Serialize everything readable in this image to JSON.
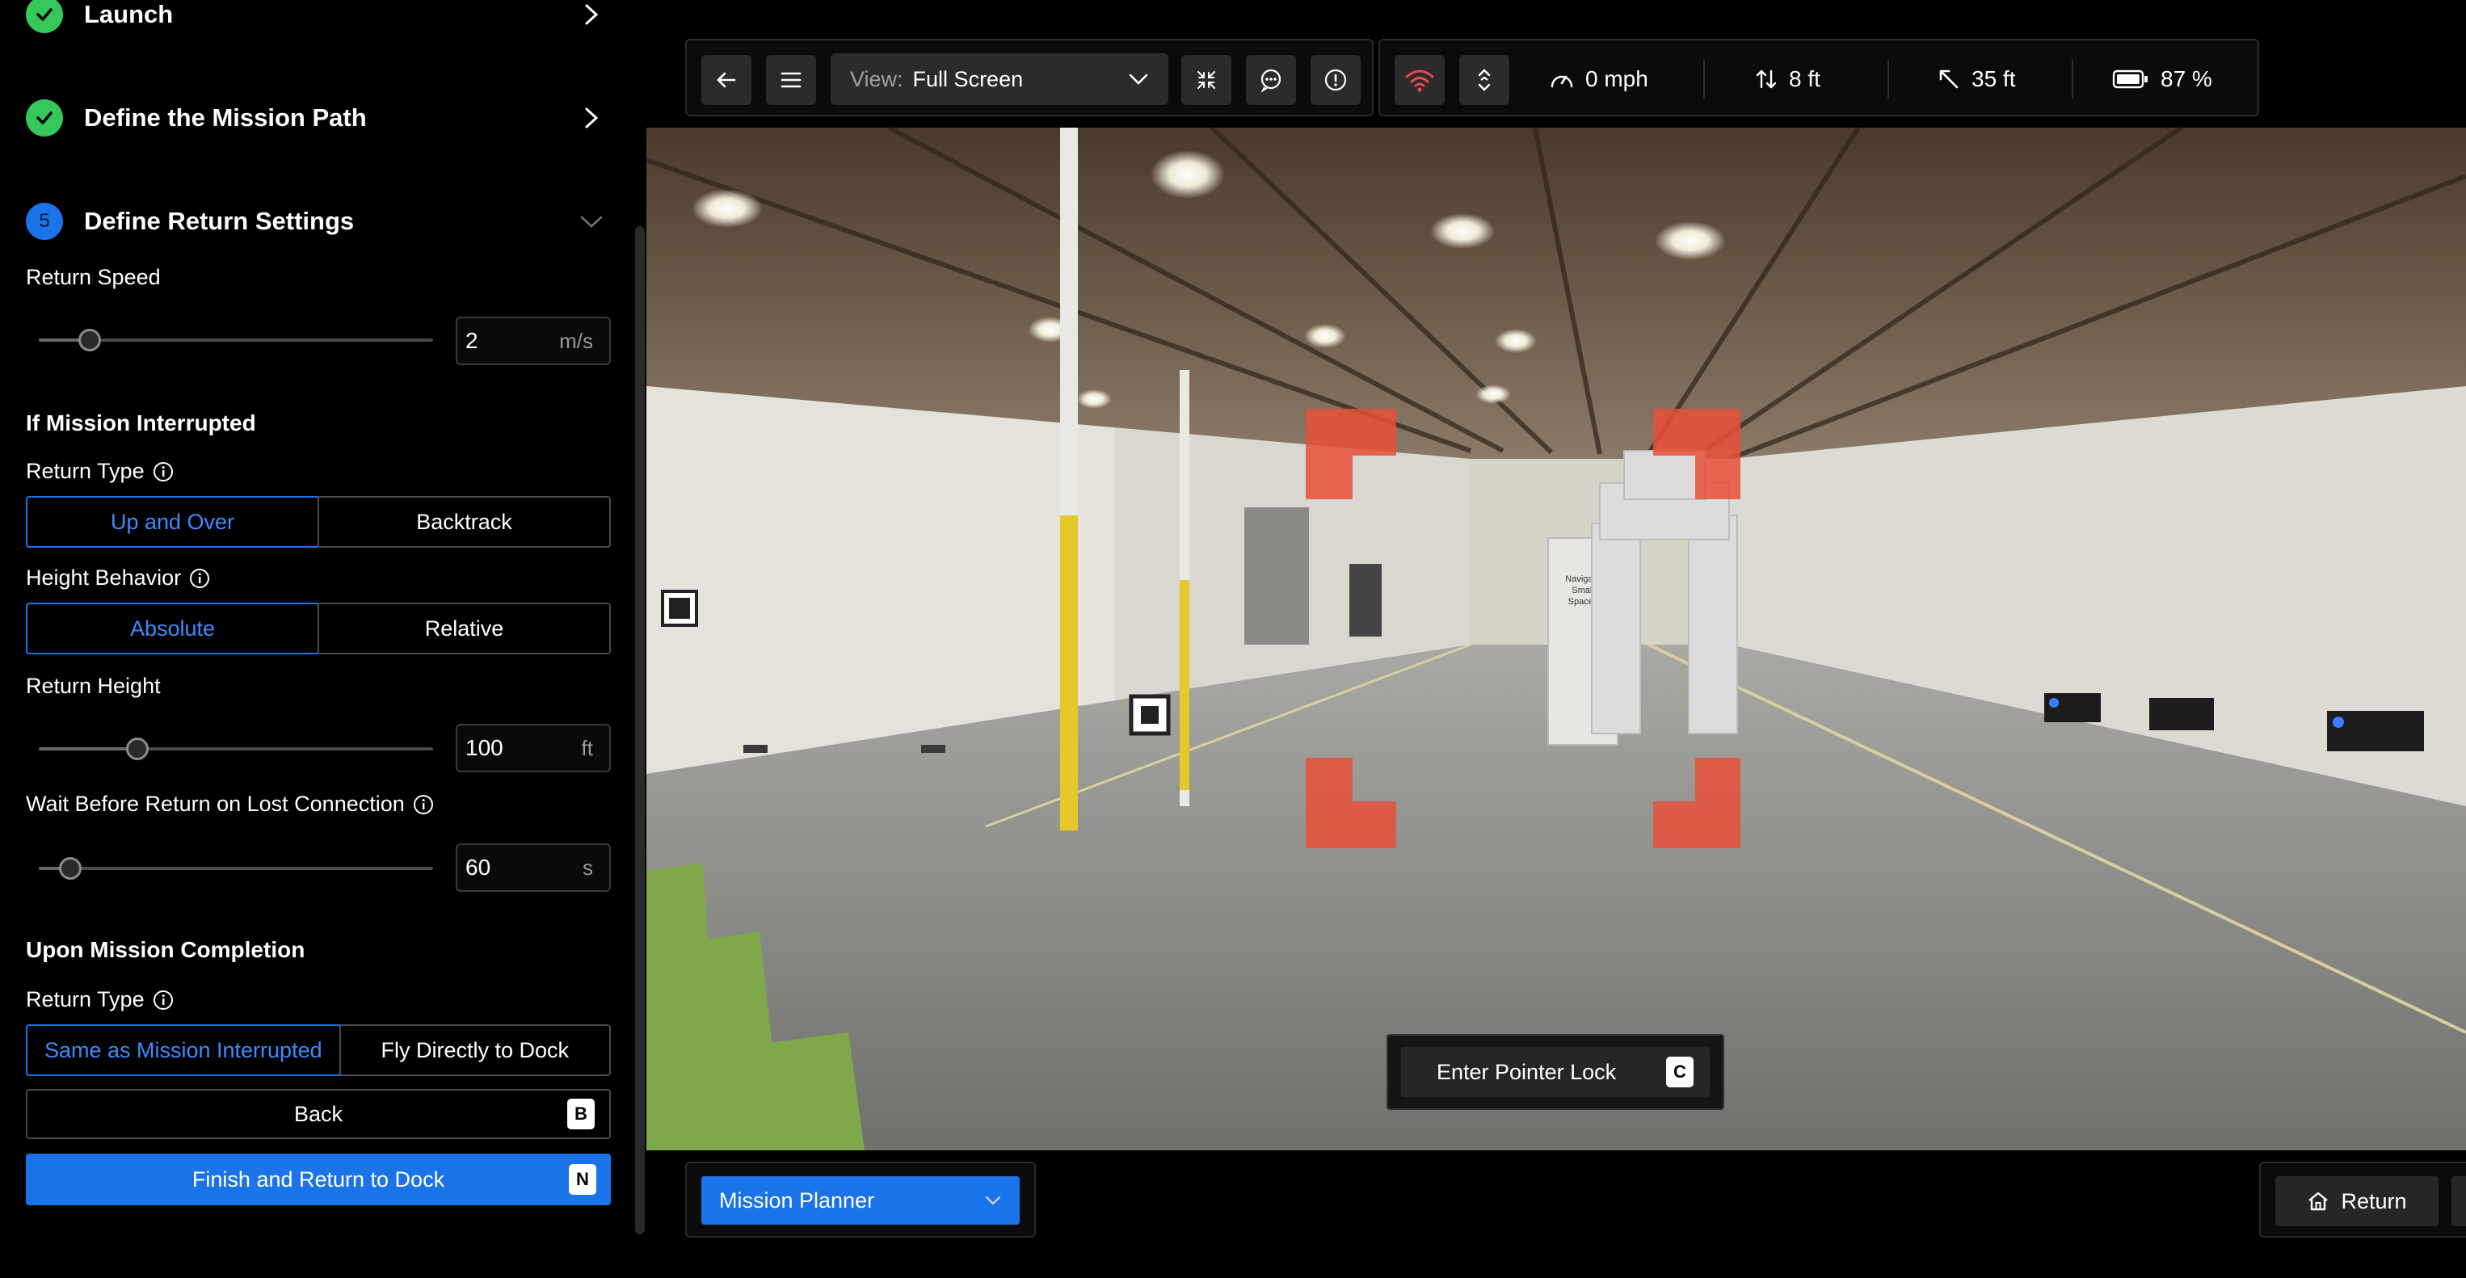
{
  "steps": [
    {
      "title": "Launch",
      "state": "complete"
    },
    {
      "title": "Define the Mission Path",
      "state": "complete"
    },
    {
      "title": "Define Return Settings",
      "state": "active",
      "number": "5"
    }
  ],
  "return_speed": {
    "label": "Return Speed",
    "value": "2",
    "unit": "m/s",
    "slider_fraction": 0.13
  },
  "interrupted": {
    "heading": "If Mission Interrupted",
    "return_type": {
      "label": "Return Type",
      "options": [
        "Up and Over",
        "Backtrack"
      ],
      "selected": "Up and Over"
    },
    "height_behavior": {
      "label": "Height Behavior",
      "options": [
        "Absolute",
        "Relative"
      ],
      "selected": "Absolute"
    },
    "return_height": {
      "label": "Return Height",
      "value": "100",
      "unit": "ft",
      "slider_fraction": 0.25
    },
    "wait_lost": {
      "label": "Wait Before Return on Lost Connection",
      "value": "60",
      "unit": "s",
      "slider_fraction": 0.08
    }
  },
  "completion": {
    "heading": "Upon Mission Completion",
    "return_type": {
      "label": "Return Type",
      "options": [
        "Same as Mission Interrupted",
        "Fly Directly to Dock"
      ],
      "selected": "Same as Mission Interrupted"
    }
  },
  "actions": {
    "back_label": "Back",
    "back_key": "B",
    "finish_label": "Finish and Return to Dock",
    "finish_key": "N"
  },
  "toolbar": {
    "view_label": "View:",
    "view_value": "Full Screen",
    "speed": "0 mph",
    "altitude": "8 ft",
    "distance": "35 ft",
    "battery": "87 %",
    "battery_level": 0.87
  },
  "camera": {
    "sign_text": [
      "Navigate",
      "Small",
      "Spaces"
    ]
  },
  "pointer_lock": {
    "label": "Enter Pointer Lock",
    "key": "C"
  },
  "bottom": {
    "mission_planner": "Mission Planner",
    "return_label": "Return"
  },
  "colors": {
    "accent": "#1a73e8",
    "success": "#34c759",
    "target": "#e8503a"
  }
}
